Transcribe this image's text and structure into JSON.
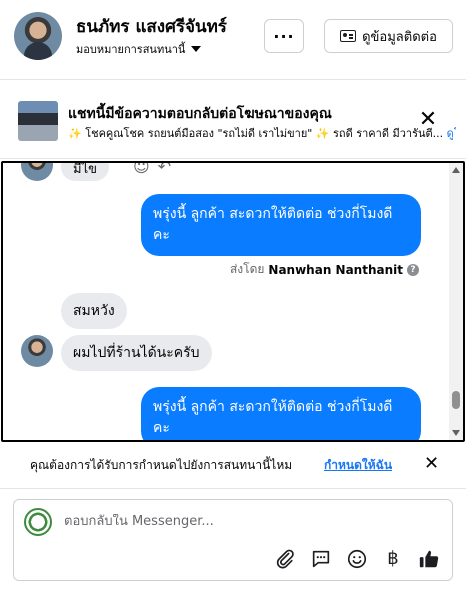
{
  "header": {
    "user_name": "ธนภัทร แสงศรีจันทร์",
    "assign_label": "มอบหมายการสนทนานี้",
    "more_label": "···",
    "contact_label": "ดูข้อมูลติดต่อ"
  },
  "ad_notice": {
    "title": "แชทนี้มีข้อความตอบกลับต่อโฆษณาของคุณ",
    "desc_icon": "✨",
    "description": " โชคคูณโชค รถยนต์มือสอง \"รถไม่ดี เราไม่ขาย\" ✨ รถดี ราคาดี มีวารันตี...",
    "link": "ดูโพ",
    "close_label": "✕"
  },
  "chat": {
    "cut_message": "มีไข",
    "messages": [
      {
        "text": "พรุ่งนี้ ลูกค้า สะดวกให้ติดต่อ ช่วงกี่โมงดีคะ"
      },
      {
        "text": "สมหวัง"
      },
      {
        "text": "ผมไปที่ร้านได้นะครับ"
      },
      {
        "text": "พรุ่งนี้ ลูกค้า สะดวกให้ติดต่อ ช่วงกี่โมงดีคะ"
      }
    ],
    "sent_by_prefix": "ส่งโดย",
    "sent_by_name": "Nanwhan Nanthanit",
    "info_glyph": "?"
  },
  "routing": {
    "text": "คุณต้องการได้รับการกำหนดไปยังการสนทนานี้ไหม",
    "link": "กำหนดให้ฉัน",
    "close_label": "✕"
  },
  "composer": {
    "placeholder": "ตอบกลับใน Messenger...",
    "baht_glyph": "฿"
  }
}
